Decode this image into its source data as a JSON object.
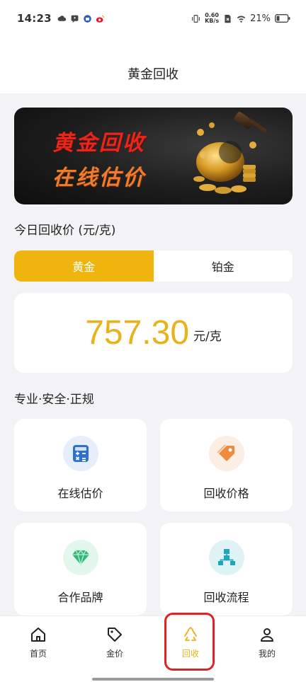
{
  "status_bar": {
    "time": "14:23",
    "net_speed_value": "0.60",
    "net_speed_unit": "KB/s",
    "battery": "21%"
  },
  "header": {
    "title": "黄金回收"
  },
  "banner": {
    "line1": "黄金回收",
    "line2": "在线估价"
  },
  "price_section": {
    "title": "今日回收价 (元/克)",
    "tabs": [
      {
        "label": "黄金",
        "active": true
      },
      {
        "label": "铂金",
        "active": false
      }
    ],
    "price": "757.30",
    "unit": "元/克"
  },
  "features_section": {
    "title": "专业·安全·正规",
    "items": [
      {
        "label": "在线估价",
        "icon": "calculator-icon",
        "color": "#2f6fd0",
        "bg": "#e6eefb"
      },
      {
        "label": "回收价格",
        "icon": "price-tag-icon",
        "color": "#f08a3c",
        "bg": "#fdeee4"
      },
      {
        "label": "合作品牌",
        "icon": "diamond-icon",
        "color": "#2fb777",
        "bg": "#e3f7ec"
      },
      {
        "label": "回收流程",
        "icon": "flowchart-icon",
        "color": "#1fa6bf",
        "bg": "#dff3f7"
      }
    ]
  },
  "bottom_nav": {
    "items": [
      {
        "label": "首页",
        "icon": "home-icon",
        "active": false
      },
      {
        "label": "金价",
        "icon": "tag-icon",
        "active": false
      },
      {
        "label": "回收",
        "icon": "recycle-icon",
        "active": true
      },
      {
        "label": "我的",
        "icon": "user-icon",
        "active": false
      }
    ]
  },
  "colors": {
    "accent": "#f0b40e",
    "price": "#e9b21c",
    "highlight": "#d9252a"
  }
}
